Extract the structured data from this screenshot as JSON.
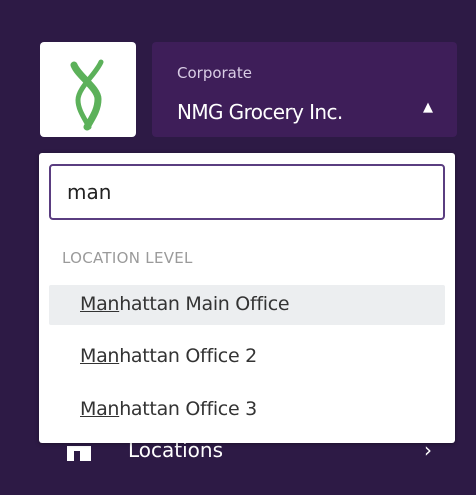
{
  "header": {
    "org_caption": "Corporate",
    "org_name": "NMG Grocery Inc.",
    "caret_glyph": "▲",
    "logo_icon": "x-logo-icon"
  },
  "background_nav": {
    "label": "Locations",
    "icon": "store-icon",
    "chevron": "›"
  },
  "dropdown": {
    "search_value": "man",
    "section_header": "LOCATION LEVEL",
    "results": [
      {
        "match": "Man",
        "rest": "hattan Main Office",
        "highlighted": true
      },
      {
        "match": "Man",
        "rest": "hattan Office 2",
        "highlighted": false
      },
      {
        "match": "Man",
        "rest": "hattan Office 3",
        "highlighted": false
      }
    ]
  },
  "colors": {
    "page_background": "#2d1a45",
    "switcher_background": "#3e1e59",
    "search_border": "#5a3d80",
    "logo_green": "#5cb15a",
    "highlight_row": "#eceef0"
  }
}
